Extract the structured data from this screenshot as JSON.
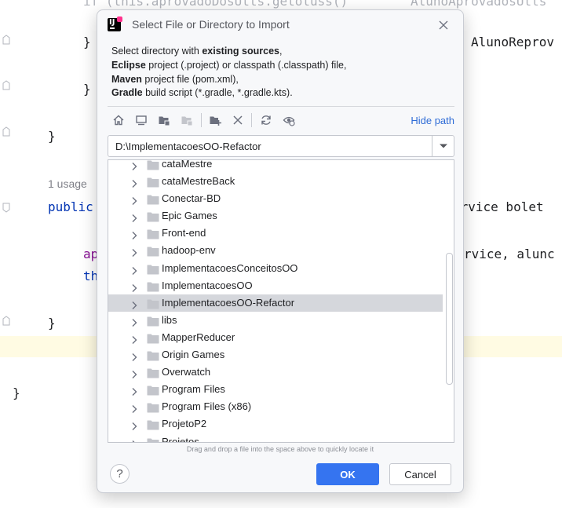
{
  "editor": {
    "lines": {
      "l1": "}",
      "l2": "}",
      "l3": "}",
      "l4": "}",
      "l5": "}",
      "usage": "1 usage",
      "public_kw": "public",
      "ap": "ap",
      "th": "th",
      "if_this": "if (this.aprovadoDosUtts.getotuss()",
      "aluno_reprov": "AlunoReprov",
      "aluno_aprov": "AlunoAprovadosUtts",
      "service_bolet": "ervice bolet",
      "rvice_aluno": "rvice, alunc"
    }
  },
  "dialog": {
    "title": "Select File or Directory to Import",
    "description": {
      "l1_pre": "Select directory with ",
      "l1_bold": "existing sources",
      "l1_post": ",",
      "l2_bold": "Eclipse",
      "l2_post": " project (.project) or classpath (.classpath) file,",
      "l3_bold": "Maven",
      "l3_post": " project file (pom.xml),",
      "l4_bold": "Gradle",
      "l4_post": " build script (*.gradle, *.gradle.kts)."
    },
    "toolbar": {
      "hide_path": "Hide path"
    },
    "path": {
      "value": "D:\\ImplementacoesOO-Refactor"
    },
    "tree": {
      "items": [
        {
          "label": "cataMestre"
        },
        {
          "label": "cataMestreBack"
        },
        {
          "label": "Conectar-BD"
        },
        {
          "label": "Epic Games"
        },
        {
          "label": "Front-end"
        },
        {
          "label": "hadoop-env"
        },
        {
          "label": "ImplementacoesConceitosOO"
        },
        {
          "label": "ImplementacoesOO"
        },
        {
          "label": "ImplementacoesOO-Refactor"
        },
        {
          "label": "libs"
        },
        {
          "label": "MapperReducer"
        },
        {
          "label": "Origin Games"
        },
        {
          "label": "Overwatch"
        },
        {
          "label": "Program Files"
        },
        {
          "label": "Program Files (x86)"
        },
        {
          "label": "ProjetoP2"
        },
        {
          "label": "Projetos"
        }
      ],
      "selected_index": 8
    },
    "drag_hint": "Drag and drop a file into the space above to quickly locate it",
    "buttons": {
      "help": "?",
      "ok": "OK",
      "cancel": "Cancel"
    }
  },
  "colors": {
    "accent": "#3574f0",
    "link": "#2e6bd6",
    "selection": "#d5d7dc",
    "keyword": "#0033b3",
    "field": "#871094"
  }
}
